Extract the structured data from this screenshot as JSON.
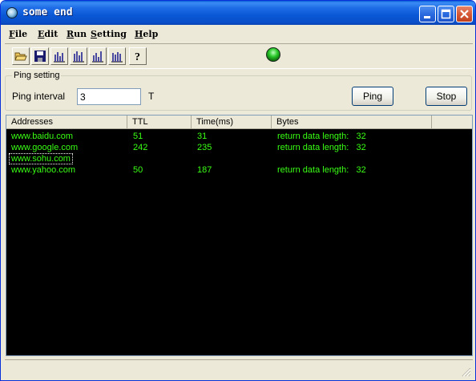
{
  "window": {
    "title": "some end",
    "icon": "app-globe-icon",
    "controls": [
      {
        "name": "minimize-button",
        "icon": "minimize-icon"
      },
      {
        "name": "maximize-button",
        "icon": "maximize-icon"
      },
      {
        "name": "close-button",
        "icon": "close-icon"
      }
    ]
  },
  "menu": [
    "File",
    "Edit",
    "Run",
    "Setting",
    "Help"
  ],
  "toolbar": {
    "buttons": [
      "open-folder-icon",
      "save-disk-icon",
      "column-chart-icon",
      "column-chart-icon",
      "column-chart-icon",
      "column-chart-icon",
      "help-icon"
    ],
    "status_indicator": "green-status-led"
  },
  "ping": {
    "group_label": "Ping setting",
    "interval_label": "Ping interval",
    "interval_value": "3",
    "unit": "T",
    "ping_button": "Ping",
    "stop_button": "Stop"
  },
  "list": {
    "columns": [
      "Addresses",
      "TTL",
      "Time(ms)",
      "Bytes"
    ],
    "rows": [
      {
        "address": "www.baidu.com",
        "ttl": "51",
        "time": "31",
        "bytes": "return data length:   32"
      },
      {
        "address": "www.google.com",
        "ttl": "242",
        "time": "235",
        "bytes": "return data length:   32"
      },
      {
        "address": "www.sohu.com",
        "ttl": "",
        "time": "",
        "bytes": ""
      },
      {
        "address": "www.yahoo.com",
        "ttl": "50",
        "time": "187",
        "bytes": "return data length:   32"
      }
    ],
    "text_color": "#39ff14",
    "background": "#000000"
  }
}
